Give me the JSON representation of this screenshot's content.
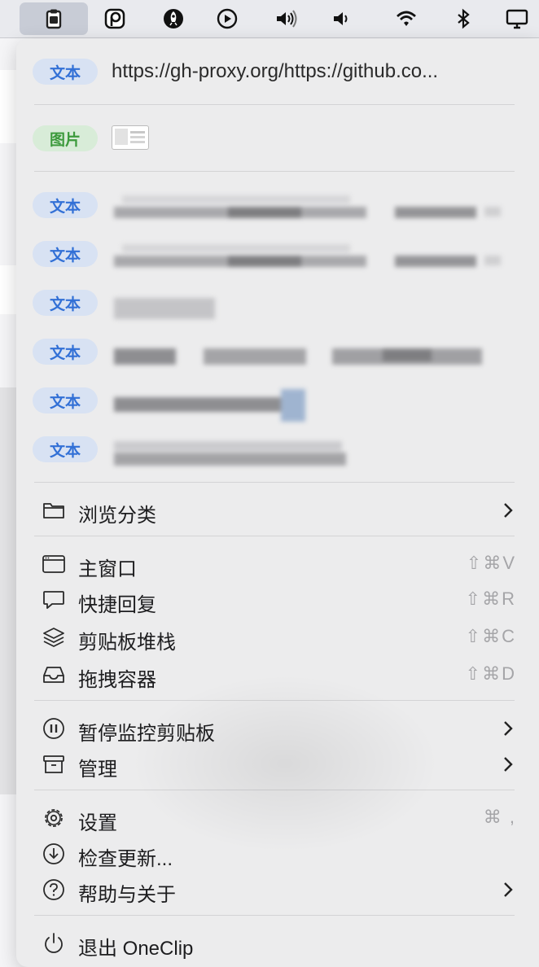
{
  "menubar": {
    "items": [
      {
        "icon": "clipboard-icon",
        "active": true
      },
      {
        "icon": "pastebot-icon"
      },
      {
        "icon": "rocket-icon"
      },
      {
        "icon": "play-circle-icon"
      },
      {
        "icon": "volume-icon"
      },
      {
        "icon": "volume-low-icon"
      },
      {
        "icon": "wifi-icon"
      },
      {
        "icon": "bluetooth-icon"
      },
      {
        "icon": "display-icon"
      }
    ]
  },
  "history": {
    "items": [
      {
        "tag": "文本",
        "kind": "text",
        "content": "https://gh-proxy.org/https://github.co..."
      },
      {
        "tag": "图片",
        "kind": "image",
        "content": ""
      },
      {
        "tag": "文本",
        "kind": "text",
        "content": ""
      },
      {
        "tag": "文本",
        "kind": "text",
        "content": ""
      },
      {
        "tag": "文本",
        "kind": "text",
        "content": ""
      },
      {
        "tag": "文本",
        "kind": "text",
        "content": ""
      },
      {
        "tag": "文本",
        "kind": "text",
        "content": ""
      },
      {
        "tag": "文本",
        "kind": "text",
        "content": ""
      }
    ]
  },
  "menu": {
    "browse": {
      "label": "浏览分类",
      "icon": "folder-icon"
    },
    "main_window": {
      "label": "主窗口",
      "shortcut": "⇧⌘V",
      "icon": "window-icon"
    },
    "quick_reply": {
      "label": "快捷回复",
      "shortcut": "⇧⌘R",
      "icon": "speech-bubble-icon"
    },
    "clipboard_stack": {
      "label": "剪贴板堆栈",
      "shortcut": "⇧⌘C",
      "icon": "layers-icon"
    },
    "drag_container": {
      "label": "拖拽容器",
      "shortcut": "⇧⌘D",
      "icon": "tray-icon"
    },
    "pause_monitor": {
      "label": "暂停监控剪贴板",
      "icon": "pause-circle-icon"
    },
    "manage": {
      "label": "管理",
      "icon": "archive-icon"
    },
    "settings": {
      "label": "设置",
      "shortcut": "⌘ ,",
      "icon": "gear-icon"
    },
    "check_updates": {
      "label": "检查更新...",
      "icon": "download-circle-icon"
    },
    "help_about": {
      "label": "帮助与关于",
      "icon": "question-circle-icon"
    },
    "quit": {
      "label": "退出 OneClip",
      "icon": "power-icon"
    }
  },
  "colors": {
    "tag_text_bg": "#d8e2f3",
    "tag_text_fg": "#3270d6",
    "tag_image_bg": "#d8ecd8",
    "tag_image_fg": "#3c9a3c",
    "menu_bg": "#ececed"
  }
}
